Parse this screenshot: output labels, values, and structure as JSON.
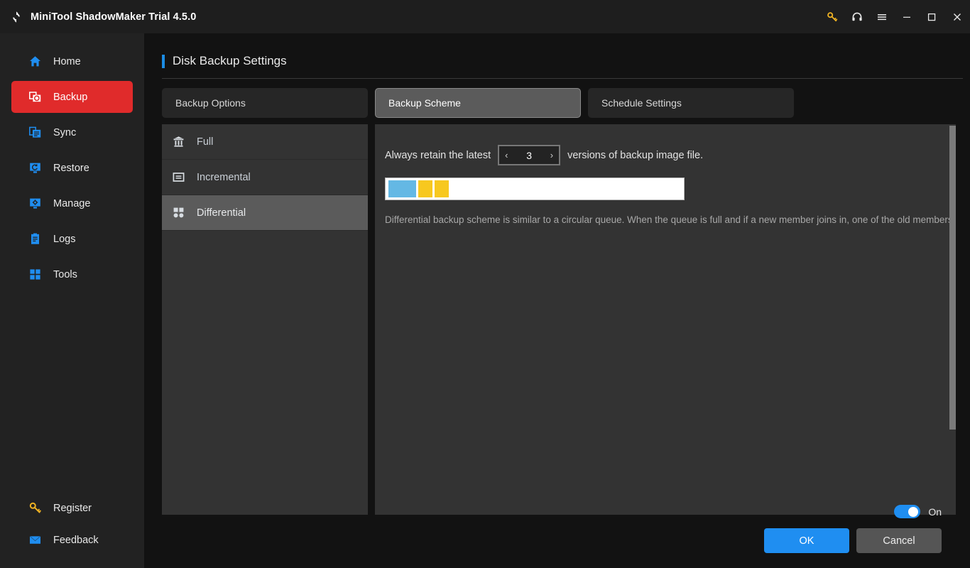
{
  "titlebar": {
    "app_title": "MiniTool ShadowMaker Trial 4.5.0",
    "logo_icon": "shadowmaker-logo-icon",
    "buttons": [
      {
        "name": "key-icon",
        "label": "",
        "color": "#f0b323"
      },
      {
        "name": "headset-icon",
        "label": "",
        "color": "#e8e8e8"
      },
      {
        "name": "hamburger-menu-icon",
        "label": "",
        "color": "#e8e8e8"
      },
      {
        "name": "minimize-icon",
        "label": "",
        "color": "#e8e8e8"
      },
      {
        "name": "maximize-icon",
        "label": "",
        "color": "#e8e8e8"
      },
      {
        "name": "close-icon",
        "label": "",
        "color": "#e8e8e8"
      }
    ]
  },
  "sidebar": {
    "items": [
      {
        "label": "Home",
        "icon": "home-icon",
        "active": false
      },
      {
        "label": "Backup",
        "icon": "backup-icon",
        "active": true
      },
      {
        "label": "Sync",
        "icon": "sync-icon",
        "active": false
      },
      {
        "label": "Restore",
        "icon": "restore-icon",
        "active": false
      },
      {
        "label": "Manage",
        "icon": "manage-icon",
        "active": false
      },
      {
        "label": "Logs",
        "icon": "logs-icon",
        "active": false
      },
      {
        "label": "Tools",
        "icon": "tools-icon",
        "active": false
      }
    ],
    "bottom_items": [
      {
        "label": "Register",
        "icon": "key-icon"
      },
      {
        "label": "Feedback",
        "icon": "mail-icon"
      }
    ],
    "active_color": "#e02b2b",
    "icon_color": "#1f8ef1"
  },
  "page": {
    "title": "Disk Backup Settings",
    "accent_color": "#1b8ce3"
  },
  "tabs": [
    {
      "label": "Backup Options",
      "active": false
    },
    {
      "label": "Backup Scheme",
      "active": true
    },
    {
      "label": "Schedule Settings",
      "active": false
    }
  ],
  "scheme_list": [
    {
      "label": "Full",
      "icon": "full-backup-icon",
      "selected": false
    },
    {
      "label": "Incremental",
      "icon": "incremental-backup-icon",
      "selected": false
    },
    {
      "label": "Differential",
      "icon": "differential-backup-icon",
      "selected": true
    }
  ],
  "scheme_detail": {
    "retain_prefix": "Always retain the latest",
    "retain_suffix": "versions of backup image file.",
    "retain_value": "3",
    "prev_arrow": "‹",
    "next_arrow": "›",
    "queue_blocks": [
      {
        "type": "base",
        "color": "#64b8e4"
      },
      {
        "type": "differential",
        "color": "#f7c81f"
      },
      {
        "type": "differential",
        "color": "#f7c81f"
      }
    ],
    "description": "Differential backup scheme is similar to a circular queue. When the queue is full and if a new member joins in, one of the old members will exit from the queue."
  },
  "footer": {
    "toggle_label": "On",
    "toggle_on": true,
    "toggle_color": "#1f8ef1",
    "ok_label": "OK",
    "cancel_label": "Cancel"
  }
}
